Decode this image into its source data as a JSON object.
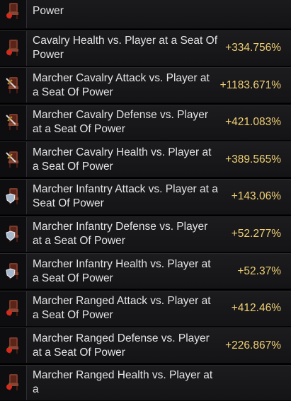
{
  "rows": [
    {
      "label": "Power",
      "value": "",
      "icon": "throne-apple-icon"
    },
    {
      "label": "Cavalry Health vs. Player at a Seat Of Power",
      "value": "+334.756%",
      "icon": "throne-apple-icon"
    },
    {
      "label": "Marcher Cavalry Attack vs. Player at a Seat Of Power",
      "value": "+1183.671%",
      "icon": "throne-sword-icon"
    },
    {
      "label": "Marcher Cavalry Defense vs. Player at a Seat Of Power",
      "value": "+421.083%",
      "icon": "throne-sword-icon"
    },
    {
      "label": "Marcher Cavalry Health vs. Player at a Seat Of Power",
      "value": "+389.565%",
      "icon": "throne-sword-icon"
    },
    {
      "label": "Marcher Infantry Attack vs. Player at a Seat Of Power",
      "value": "+143.06%",
      "icon": "throne-shield-icon"
    },
    {
      "label": "Marcher Infantry Defense vs. Player at a Seat Of Power",
      "value": "+52.277%",
      "icon": "throne-shield-icon"
    },
    {
      "label": "Marcher Infantry Health vs. Player at a Seat Of Power",
      "value": "+52.37%",
      "icon": "throne-shield-icon"
    },
    {
      "label": "Marcher Ranged Attack vs. Player at a Seat Of Power",
      "value": "+412.46%",
      "icon": "throne-apple-icon"
    },
    {
      "label": "Marcher Ranged Defense vs. Player at a Seat Of Power",
      "value": "+226.867%",
      "icon": "throne-apple-icon"
    },
    {
      "label": "Marcher Ranged Health vs. Player at a",
      "value": "",
      "icon": "throne-apple-icon"
    }
  ]
}
